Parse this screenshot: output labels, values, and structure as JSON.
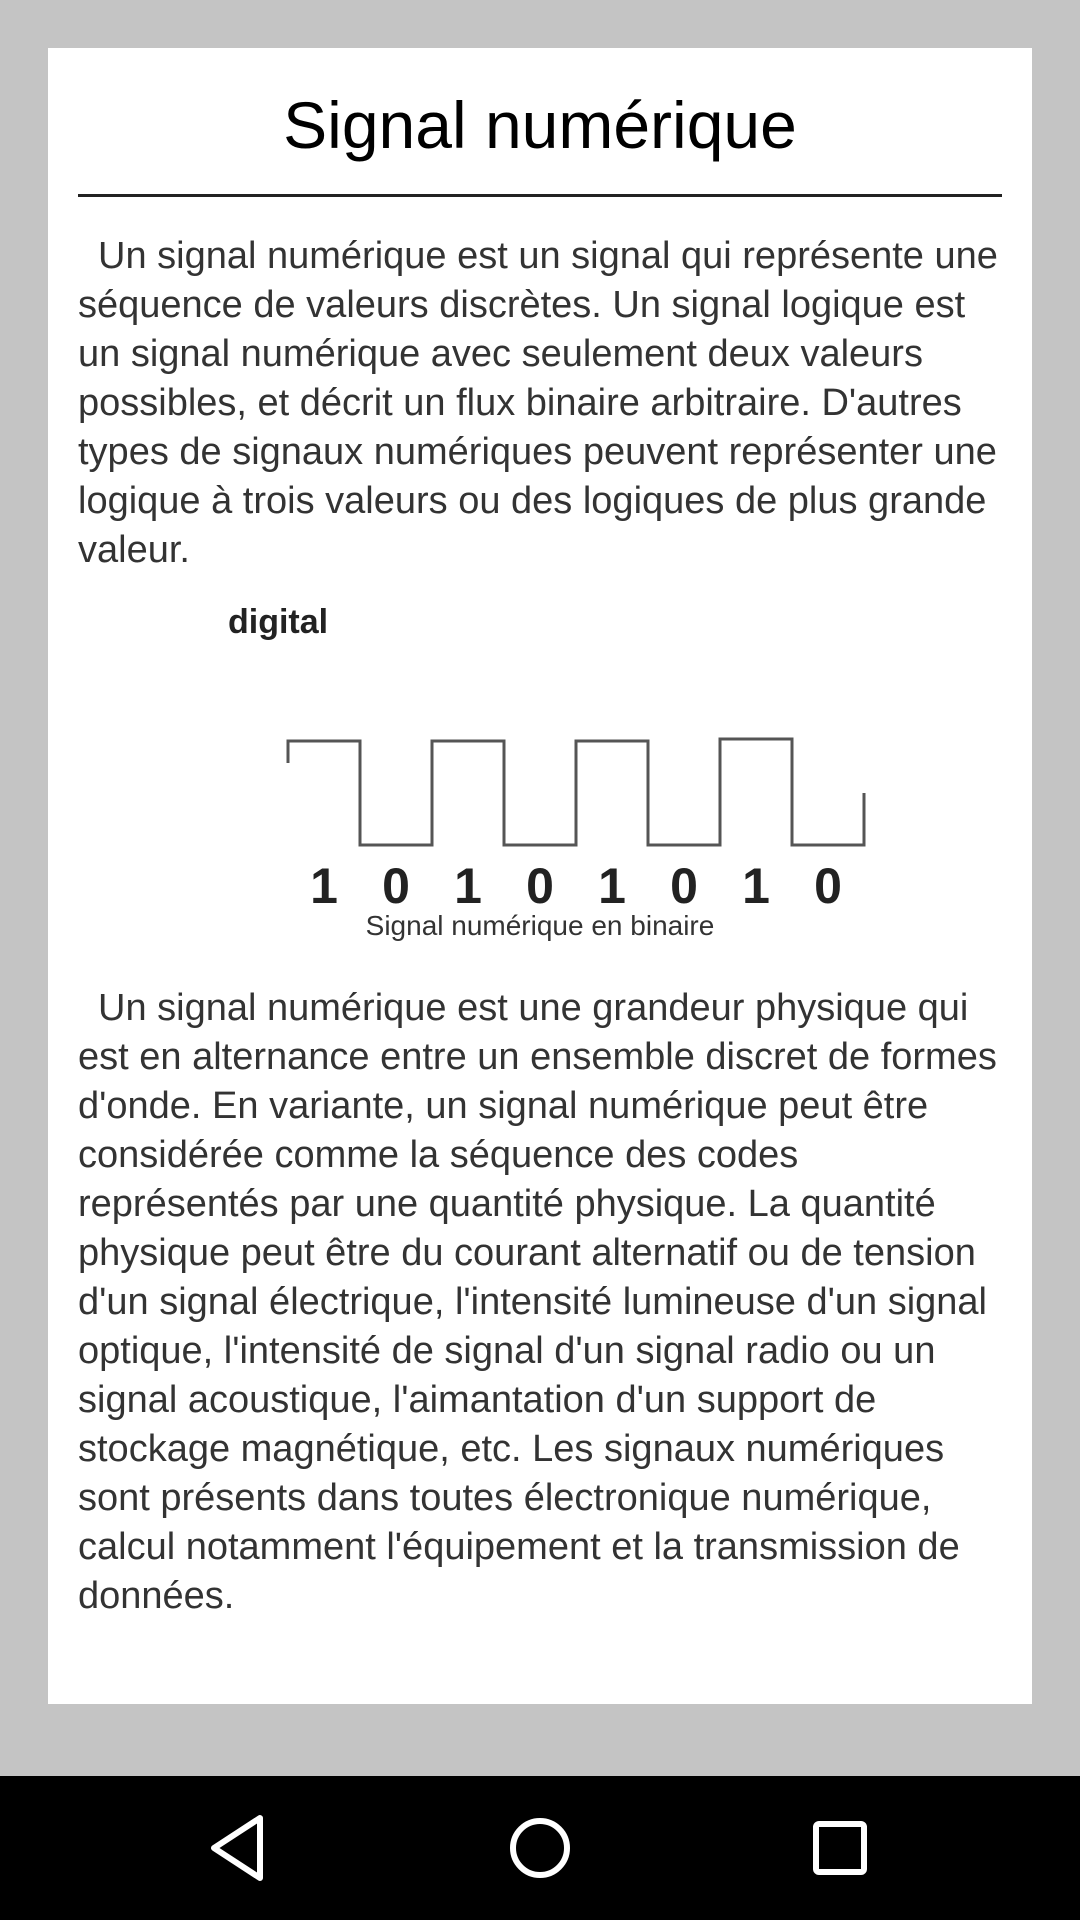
{
  "article": {
    "title": "Signal numérique",
    "paragraph1": "Un signal numérique est un signal qui représente une séquence de valeurs discrètes. Un signal logique est un signal numérique avec seulement deux valeurs possibles, et décrit un flux binaire arbitraire. D'autres types de signaux numériques peuvent représenter une logique à trois valeurs ou des logiques de plus grande valeur.",
    "figure": {
      "label": "digital",
      "bits": [
        "1",
        "0",
        "1",
        "0",
        "1",
        "0",
        "1",
        "0"
      ],
      "caption": "Signal numérique en binaire"
    },
    "paragraph2": "Un signal numérique est une grandeur physique qui est en alternance entre un ensemble discret de formes d'onde. En variante, un signal numérique peut être considérée comme la séquence des codes représentés par une quantité physique. La quantité physique peut être du courant alternatif ou de tension d'un signal électrique, l'intensité lumineuse d'un signal optique, l'intensité de signal d'un signal radio ou un signal acoustique, l'aimantation d'un support de stockage magnétique, etc. Les signaux numériques sont présents dans toutes électronique numérique, calcul notamment l'équipement et la transmission de données."
  },
  "navigation": {
    "back_icon": "back-triangle-icon",
    "home_icon": "home-circle-icon",
    "recent_icon": "recent-square-icon"
  }
}
